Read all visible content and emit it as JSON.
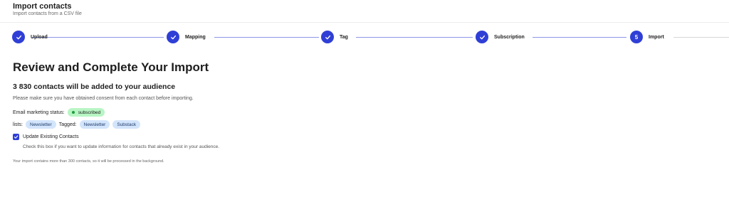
{
  "header": {
    "title": "Import contacts",
    "subtitle": "Import contacts from a CSV file"
  },
  "stepper": {
    "steps": [
      {
        "label": "Upload",
        "state": "done",
        "number": ""
      },
      {
        "label": "Mapping",
        "state": "done",
        "number": ""
      },
      {
        "label": "Tag",
        "state": "done",
        "number": ""
      },
      {
        "label": "Subscription",
        "state": "done",
        "number": ""
      },
      {
        "label": "Import",
        "state": "current",
        "number": "5"
      }
    ],
    "icons": {
      "done": "check-icon"
    },
    "colors": {
      "active": "#2f3fd6",
      "connector": "#8d97e6"
    }
  },
  "review": {
    "heading": "Review and Complete Your Import",
    "summary": "3 830 contacts will be added to your audience",
    "consent_note": "Please make sure you have obtained consent from each contact before importing.",
    "status_label": "Email marketing status:",
    "status_value": "subscribed",
    "lists_label": "lists:",
    "lists": [
      "Newsletter"
    ],
    "tagged_label": "Tagged:",
    "tags": [
      "Newsletter",
      "Substack"
    ],
    "update_existing": {
      "label": "Update Existing Contacts",
      "checked": true,
      "help": "Check this box if you want to update information for contacts that already exist in your audience."
    },
    "background_note": "Your import contains more than 300 contacts, so it will be processed in the background."
  }
}
